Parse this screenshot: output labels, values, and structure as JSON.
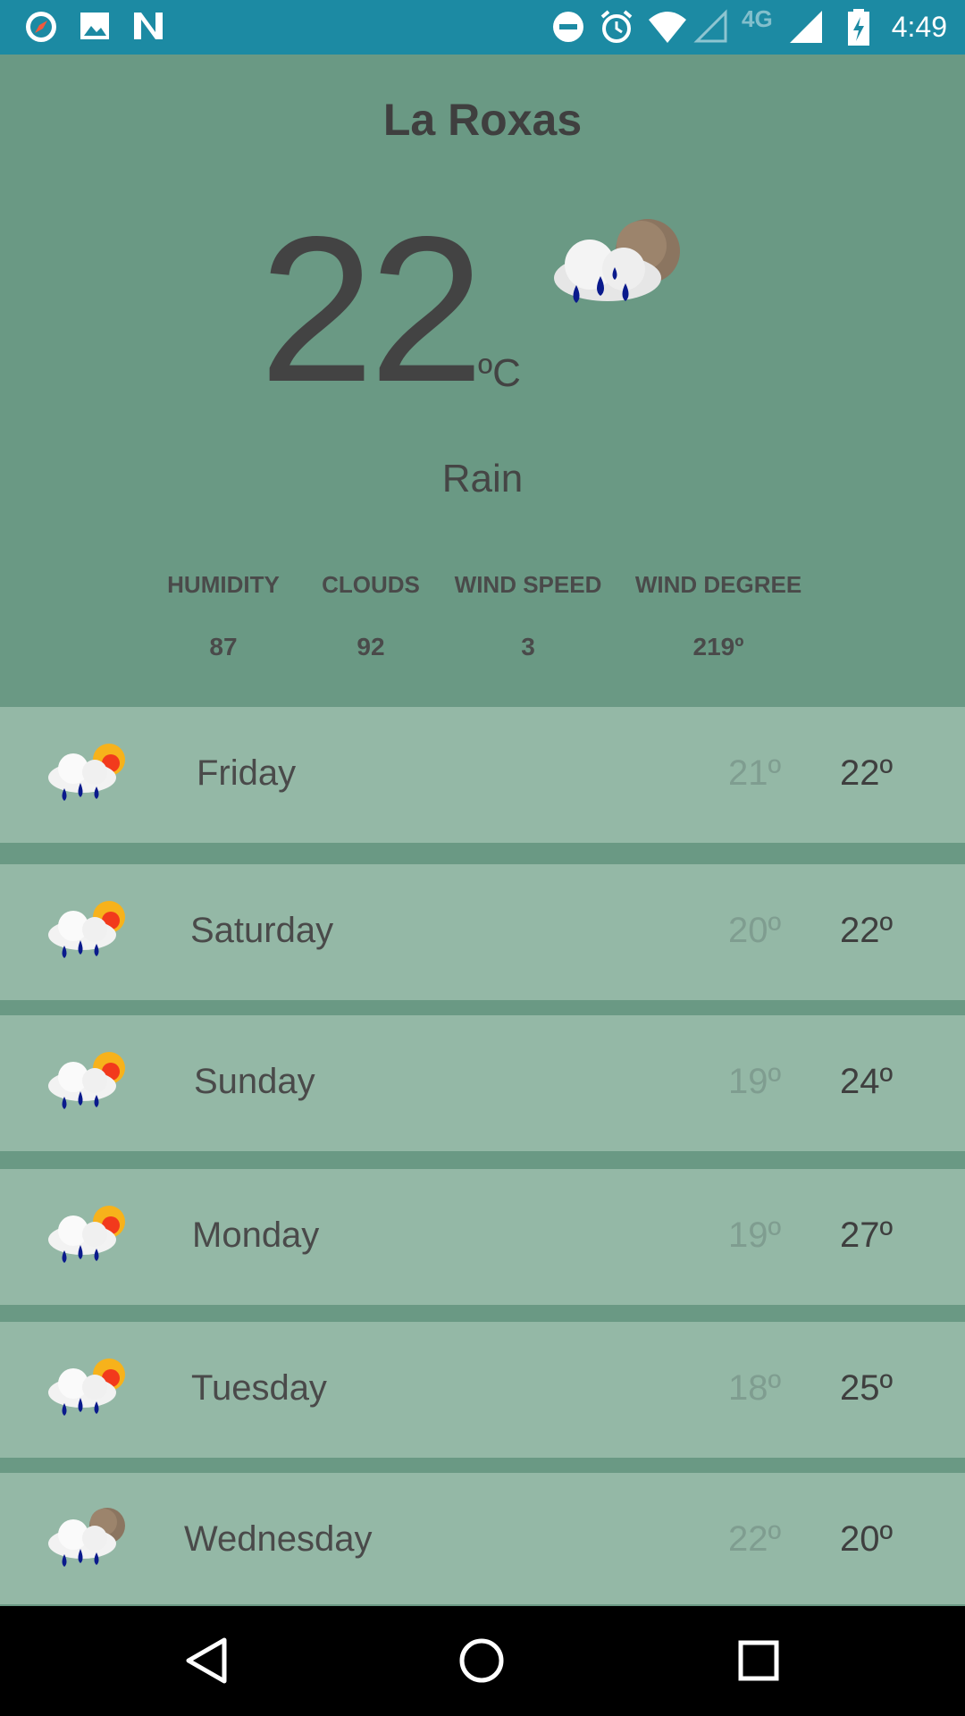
{
  "status_bar": {
    "time": "4:49",
    "network": "4G",
    "left_icons": [
      "compass-icon",
      "image-icon",
      "n-logo-icon"
    ],
    "right_icons": [
      "dnd-icon",
      "alarm-icon",
      "wifi-icon",
      "signal-empty-icon",
      "signal-icon",
      "battery-charging-icon"
    ]
  },
  "current": {
    "city": "La Roxas",
    "temperature": "22",
    "unit": "ºC",
    "condition": "Rain",
    "icon": "rain-cloud-moon-icon"
  },
  "stats": [
    {
      "label": "HUMIDITY",
      "value": "87"
    },
    {
      "label": "CLOUDS",
      "value": "92"
    },
    {
      "label": "WIND SPEED",
      "value": "3"
    },
    {
      "label": "WIND DEGREE",
      "value": "219º"
    }
  ],
  "forecast": [
    {
      "day": "Friday",
      "low": "21º",
      "high": "22º",
      "icon": "rain-cloud-sun-icon"
    },
    {
      "day": "Saturday",
      "low": "20º",
      "high": "22º",
      "icon": "rain-cloud-sun-icon"
    },
    {
      "day": "Sunday",
      "low": "19º",
      "high": "24º",
      "icon": "rain-cloud-sun-icon"
    },
    {
      "day": "Monday",
      "low": "19º",
      "high": "27º",
      "icon": "rain-cloud-sun-icon"
    },
    {
      "day": "Tuesday",
      "low": "18º",
      "high": "25º",
      "icon": "rain-cloud-sun-icon"
    },
    {
      "day": "Wednesday",
      "low": "22º",
      "high": "20º",
      "icon": "rain-cloud-moon-icon"
    }
  ],
  "colors": {
    "status_bar": "#1c8aa3",
    "background": "#6a9984",
    "row": "#94b8a6",
    "nav_bar": "#000000"
  },
  "nav_bar": [
    "back-icon",
    "home-icon",
    "recents-icon"
  ]
}
